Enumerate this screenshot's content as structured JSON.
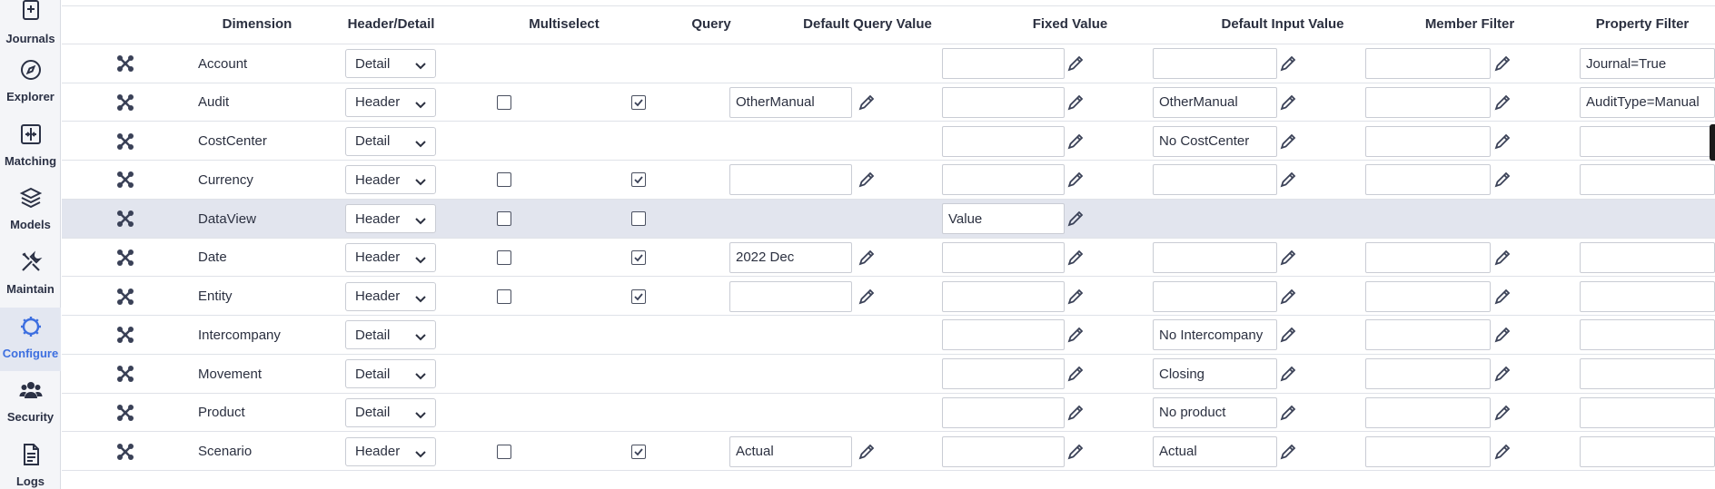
{
  "sidebar": {
    "items": [
      {
        "label": "Journals",
        "icon": "journals-icon",
        "active": false
      },
      {
        "label": "Explorer",
        "icon": "compass-icon",
        "active": false
      },
      {
        "label": "Matching",
        "icon": "matching-icon",
        "active": false
      },
      {
        "label": "Models",
        "icon": "layers-icon",
        "active": false
      },
      {
        "label": "Maintain",
        "icon": "tools-icon",
        "active": false
      },
      {
        "label": "Configure",
        "icon": "gear-icon",
        "active": true
      },
      {
        "label": "Security",
        "icon": "users-icon",
        "active": false
      },
      {
        "label": "Logs",
        "icon": "document-icon",
        "active": false
      }
    ],
    "active_color": "#3d6fe0"
  },
  "table": {
    "columns": {
      "dimension": "Dimension",
      "header_detail": "Header/Detail",
      "multiselect": "Multiselect",
      "query": "Query",
      "default_query_value": "Default Query Value",
      "fixed_value": "Fixed Value",
      "default_input_value": "Default Input Value",
      "member_filter": "Member Filter",
      "property_filter": "Property Filter"
    },
    "rows": [
      {
        "dimension": "Account",
        "type": "Detail",
        "multiselect": null,
        "query": null,
        "default_query_value": null,
        "fixed_value": "",
        "default_input_value": "",
        "member_filter": "",
        "property_filter": "Journal=True",
        "highlight": false
      },
      {
        "dimension": "Audit",
        "type": "Header",
        "multiselect": false,
        "query": true,
        "default_query_value": "OtherManual",
        "fixed_value": "",
        "default_input_value": "OtherManual",
        "member_filter": "",
        "property_filter": "AuditType=Manual",
        "highlight": false
      },
      {
        "dimension": "CostCenter",
        "type": "Detail",
        "multiselect": null,
        "query": null,
        "default_query_value": null,
        "fixed_value": "",
        "default_input_value": "No CostCenter",
        "member_filter": "",
        "property_filter": "",
        "highlight": false
      },
      {
        "dimension": "Currency",
        "type": "Header",
        "multiselect": false,
        "query": true,
        "default_query_value": "",
        "fixed_value": "",
        "default_input_value": "",
        "member_filter": "",
        "property_filter": "",
        "highlight": false
      },
      {
        "dimension": "DataView",
        "type": "Header",
        "multiselect": false,
        "query": false,
        "default_query_value": null,
        "fixed_value": "Value",
        "default_input_value": null,
        "member_filter": null,
        "property_filter": null,
        "highlight": true
      },
      {
        "dimension": "Date",
        "type": "Header",
        "multiselect": false,
        "query": true,
        "default_query_value": "2022 Dec",
        "fixed_value": "",
        "default_input_value": "",
        "member_filter": "",
        "property_filter": "",
        "highlight": false
      },
      {
        "dimension": "Entity",
        "type": "Header",
        "multiselect": false,
        "query": true,
        "default_query_value": "",
        "fixed_value": "",
        "default_input_value": "",
        "member_filter": "",
        "property_filter": "",
        "highlight": false
      },
      {
        "dimension": "Intercompany",
        "type": "Detail",
        "multiselect": null,
        "query": null,
        "default_query_value": null,
        "fixed_value": "",
        "default_input_value": "No Intercompany",
        "member_filter": "",
        "property_filter": "",
        "highlight": false
      },
      {
        "dimension": "Movement",
        "type": "Detail",
        "multiselect": null,
        "query": null,
        "default_query_value": null,
        "fixed_value": "",
        "default_input_value": "Closing",
        "member_filter": "",
        "property_filter": "",
        "highlight": false
      },
      {
        "dimension": "Product",
        "type": "Detail",
        "multiselect": null,
        "query": null,
        "default_query_value": null,
        "fixed_value": "",
        "default_input_value": "No product",
        "member_filter": "",
        "property_filter": "",
        "highlight": false
      },
      {
        "dimension": "Scenario",
        "type": "Header",
        "multiselect": false,
        "query": true,
        "default_query_value": "Actual",
        "fixed_value": "",
        "default_input_value": "Actual",
        "member_filter": "",
        "property_filter": "",
        "highlight": false
      }
    ]
  }
}
